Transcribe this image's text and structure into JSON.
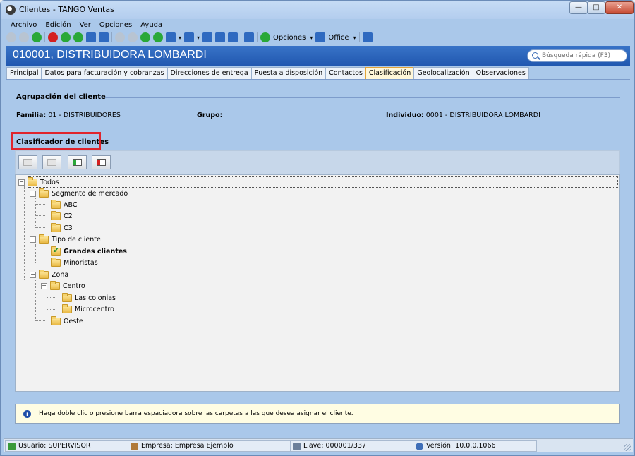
{
  "window": {
    "title": "Clientes - TANGO Ventas",
    "min_label": "—",
    "max_label": "□",
    "close_label": "✕"
  },
  "menu": [
    "Archivo",
    "Edición",
    "Ver",
    "Opciones",
    "Ayuda"
  ],
  "toolbar": {
    "opciones_label": "Opciones",
    "office_label": "Office",
    "dropdown_glyph": "▾"
  },
  "header": {
    "title": "010001, DISTRIBUIDORA LOMBARDI",
    "search_placeholder": "Búsqueda rápida (F3)"
  },
  "tabs": [
    {
      "label": "Principal",
      "active": false
    },
    {
      "label": "Datos para facturación y cobranzas",
      "active": false
    },
    {
      "label": "Direcciones de entrega",
      "active": false
    },
    {
      "label": "Puesta a disposición",
      "active": false
    },
    {
      "label": "Contactos",
      "active": false
    },
    {
      "label": "Clasificación",
      "active": true
    },
    {
      "label": "Geolocalización",
      "active": false
    },
    {
      "label": "Observaciones",
      "active": false
    }
  ],
  "agrupacion": {
    "title": "Agrupación del cliente",
    "familia_label": "Familia:",
    "familia_value": "01 - DISTRIBUIDORES",
    "grupo_label": "Grupo:",
    "grupo_value": "",
    "individuo_label": "Individuo:",
    "individuo_value": "0001 - DISTRIBUIDORA LOMBARDI"
  },
  "clasificador": {
    "title": "Clasificador de clientes"
  },
  "tree": {
    "root": "Todos",
    "segmento": "Segmento de mercado",
    "abc": "ABC",
    "c2": "C2",
    "c3": "C3",
    "tipo": "Tipo de cliente",
    "grandes": "Grandes clientes",
    "minoristas": "Minoristas",
    "zona": "Zona",
    "centro": "Centro",
    "colonias": "Las colonias",
    "microcentro": "Microcentro",
    "oeste": "Oeste",
    "collapse_glyph": "−"
  },
  "info": {
    "icon_glyph": "i",
    "text": "Haga doble clic o presione barra espaciadora sobre las carpetas a las que desea asignar el cliente."
  },
  "status": {
    "usuario": "Usuario: SUPERVISOR",
    "empresa": "Empresa: Empresa Ejemplo",
    "llave": "Llave: 000001/337",
    "version": "Versión: 10.0.0.1066"
  },
  "colors": {
    "header_bg": "#2158b0",
    "active_tab": "#fff7d9",
    "highlight": "#e0242c",
    "panel_bg": "#aac8ea"
  }
}
